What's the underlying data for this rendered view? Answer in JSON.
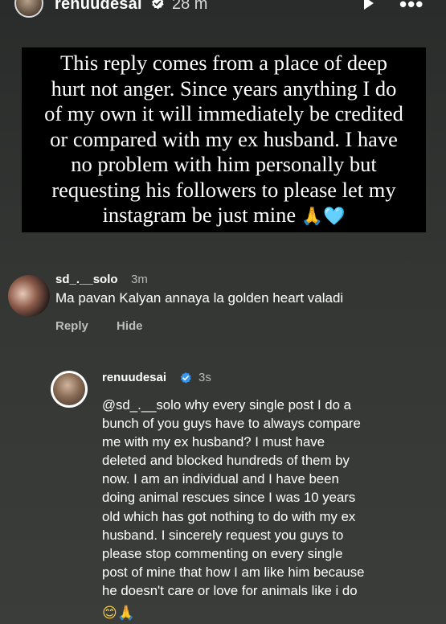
{
  "story": {
    "username": "renuudesai",
    "time": "28 m",
    "quote_lines": [
      "This reply comes from a place of deep",
      "hurt not anger. Since years anything I do",
      "of my own it will immediately be credited",
      "or compared with my ex husband. I have",
      "no problem with him personally but",
      "requesting his followers to please let my",
      "instagram be just mine"
    ],
    "quote_emoji": "🙏🩵"
  },
  "comment": {
    "username": "sd_.__solo",
    "time": "3m",
    "text": "Ma pavan Kalyan annaya la golden heart valadi",
    "reply_label": "Reply",
    "hide_label": "Hide"
  },
  "reply": {
    "username": "renuudesai",
    "time": "3s",
    "lines": [
      "@sd_.__solo why every single post I do a",
      "bunch of you guys have to always compare",
      "me with my ex husband? I must have",
      "deleted and blocked hundreds of them by",
      "now. I am an individual and I have been",
      "doing animal rescues since I was 10 years",
      "old which has got nothing to do with my ex",
      "husband. I sincerely request you guys to",
      "please stop commenting on every single",
      "post of mine that how I am like him because",
      "he doesn't care or love for animals like i do"
    ],
    "emoji_smile": "😊",
    "emoji_pray": "🙏"
  },
  "colors": {
    "background": "#323432",
    "quote_box": "#000000",
    "verified": "#3797f0",
    "secondary_text": "#b9b9b9"
  },
  "icons": {
    "top_avatar": "avatar",
    "verified": "verified-badge-icon",
    "play": "play-icon",
    "more": "more-options-icon"
  }
}
